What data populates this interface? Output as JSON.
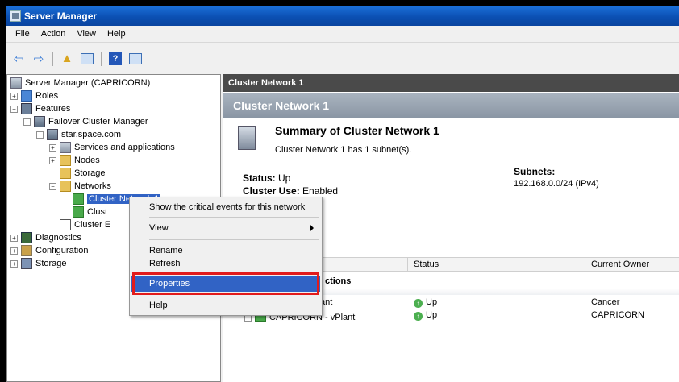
{
  "window": {
    "title": "Server Manager"
  },
  "menu": [
    "File",
    "Action",
    "View",
    "Help"
  ],
  "tree": {
    "root": "Server Manager (CAPRICORN)",
    "roles": "Roles",
    "features": "Features",
    "failover": "Failover Cluster Manager",
    "domain": "star.space.com",
    "services": "Services and applications",
    "nodes": "Nodes",
    "storage_node": "Storage",
    "networks": "Networks",
    "cluster_net1": "Cluster Network 1",
    "cluster_net2": "Clust",
    "cluster_events": "Cluster E",
    "diagnostics": "Diagnostics",
    "configuration": "Configuration",
    "storage": "Storage"
  },
  "right": {
    "header": "Cluster Network 1",
    "banner": "Cluster Network 1",
    "summary_title": "Summary of Cluster Network 1",
    "summary_sub": "Cluster Network 1 has 1 subnet(s).",
    "status_label": "Status:",
    "status_value": "Up",
    "use_label": "Cluster Use:",
    "use_value": "Enabled",
    "subnets_label": "Subnets:",
    "subnets_value": "192.168.0.0/24 (IPv4)",
    "col_status": "Status",
    "col_owner": "Current Owner",
    "group_label": "ctions",
    "rows": [
      {
        "name": "ant",
        "status": "Up",
        "owner": "Cancer"
      },
      {
        "name": "CAPRICORN - vPlant",
        "status": "Up",
        "owner": "CAPRICORN"
      }
    ]
  },
  "context_menu": {
    "items": [
      "Show the critical events for this network",
      "View",
      "Rename",
      "Refresh",
      "Properties",
      "Help"
    ],
    "selected": "Properties"
  },
  "colors": {
    "highlight": "#e21b1b",
    "selection": "#3163c5",
    "titlebar": "#0b4fb2"
  }
}
